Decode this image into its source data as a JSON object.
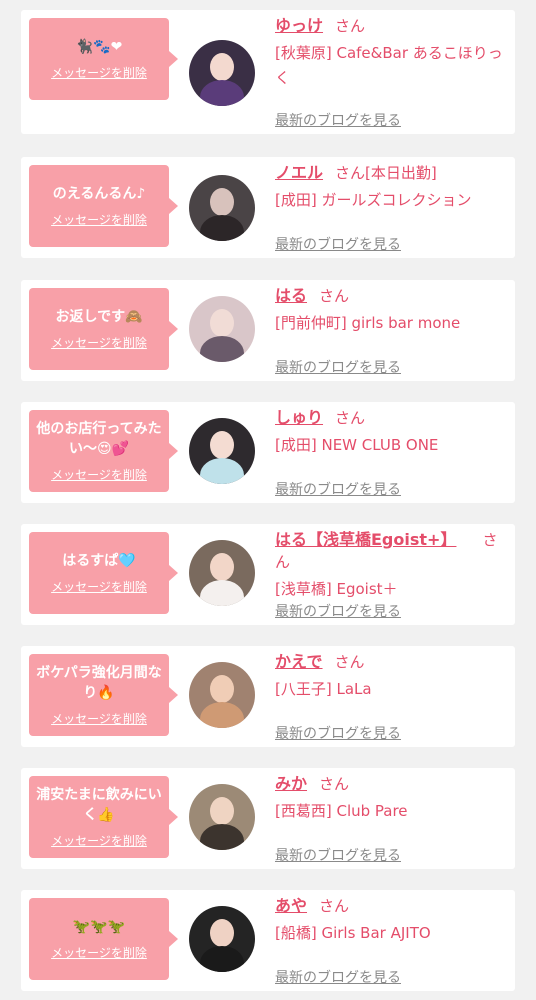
{
  "delete_label": "メッセージを削除",
  "blog_label": "最新のブログを見る",
  "san_label": "さん",
  "colors": {
    "background": "#f1f1f1",
    "bubble": "#f8a0a8",
    "accent": "#e44d6a",
    "muted": "#8a8a8a"
  },
  "cards": [
    {
      "message": "🐈‍⬛🐾❤",
      "name": "ゆっけ",
      "status": "",
      "shop": "[秋葉原] Cafe&Bar あるこほりっく"
    },
    {
      "message": "のえるんるん♪",
      "name": "ノエル",
      "status": "[本日出勤]",
      "shop": "[成田] ガールズコレクション"
    },
    {
      "message": "お返しです🙈",
      "name": "はる",
      "status": "",
      "shop": "[門前仲町] girls bar mone"
    },
    {
      "message": "他のお店行ってみたい〜😍💕",
      "name": "しゅり",
      "status": "",
      "shop": "[成田] NEW CLUB ONE"
    },
    {
      "message": "はるすぱ🩵",
      "name": "はる【浅草橋Egoist+】",
      "status": "",
      "shop": "[浅草橋] Egoist＋"
    },
    {
      "message": "ボケパラ強化月間なり🔥",
      "name": "かえで",
      "status": "",
      "shop": "[八王子] LaLa"
    },
    {
      "message": "浦安たまに飲みにいく👍",
      "name": "みか",
      "status": "",
      "shop": "[西葛西] Club Pare"
    },
    {
      "message": "🦖🦖🦖",
      "name": "あや",
      "status": "",
      "shop": "[船橋] Girls Bar AJITO"
    }
  ]
}
